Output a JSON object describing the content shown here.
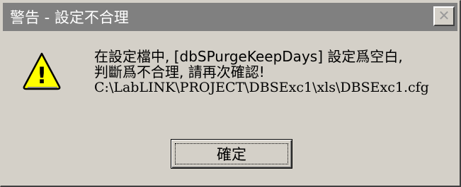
{
  "window": {
    "title": "警告 - 設定不合理",
    "close_label": "✕"
  },
  "icon": {
    "name": "warning-icon",
    "fill": "#ffff00",
    "symbol": "!"
  },
  "message": {
    "line1": "在設定檔中, [dbSPurgeKeepDays] 設定爲空白,",
    "line2": "判斷爲不合理, 請再次確認!",
    "line3": "C:\\LabLINK\\PROJECT\\DBSExc1\\xls\\DBSExc1.cfg"
  },
  "buttons": {
    "ok_label": "確定"
  },
  "colors": {
    "titlebar": "#808080",
    "face": "#d4d0c8",
    "title_text": "#ffffff"
  }
}
